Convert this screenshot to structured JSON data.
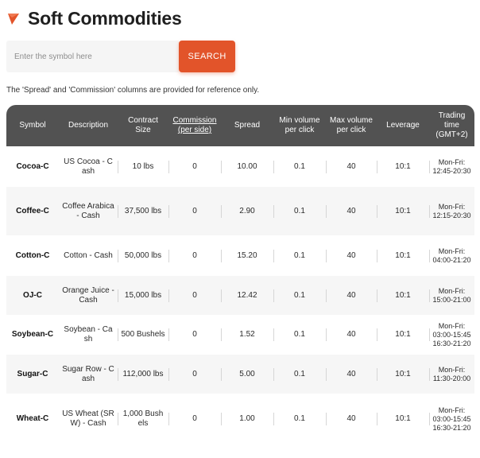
{
  "page": {
    "title": "Soft Commodities",
    "accent_color": "#e2542a",
    "header_bg": "#525252"
  },
  "search": {
    "placeholder": "Enter the symbol here",
    "button_label": "SEARCH"
  },
  "note": "The 'Spread' and 'Commission' columns are provided for reference only.",
  "table": {
    "headers": {
      "symbol": "Symbol",
      "description": "Description",
      "contract_size": "Contract Size",
      "commission": "Commission (per side)",
      "spread": "Spread",
      "min_volume": "Min volume per click",
      "max_volume": "Max volume per click",
      "leverage": "Leverage",
      "trading_time": "Trading time (GMT+2)"
    },
    "rows": [
      {
        "symbol": "Cocoa-C",
        "description": "US Cocoa - Cash",
        "contract_size": "10 lbs",
        "commission": "0",
        "spread": "10.00",
        "min_volume": "0.1",
        "max_volume": "40",
        "leverage": "10:1",
        "trading_time": [
          "Mon-Fri:",
          "12:45-20:30"
        ]
      },
      {
        "symbol": "Coffee-C",
        "description": "Coffee Arabica - Cash",
        "contract_size": "37,500 lbs",
        "commission": "0",
        "spread": "2.90",
        "min_volume": "0.1",
        "max_volume": "40",
        "leverage": "10:1",
        "trading_time": [
          "Mon-Fri:",
          "12:15-20:30"
        ]
      },
      {
        "symbol": "Cotton-C",
        "description": "Cotton - Cash",
        "contract_size": "50,000 lbs",
        "commission": "0",
        "spread": "15.20",
        "min_volume": "0.1",
        "max_volume": "40",
        "leverage": "10:1",
        "trading_time": [
          "Mon-Fri:",
          "04:00-21:20"
        ]
      },
      {
        "symbol": "OJ-C",
        "description": "Orange Juice - Cash",
        "contract_size": "15,000 lbs",
        "commission": "0",
        "spread": "12.42",
        "min_volume": "0.1",
        "max_volume": "40",
        "leverage": "10:1",
        "trading_time": [
          "Mon-Fri:",
          "15:00-21:00"
        ]
      },
      {
        "symbol": "Soybean-C",
        "description": "Soybean - Cash",
        "contract_size": "500 Bushels",
        "commission": "0",
        "spread": "1.52",
        "min_volume": "0.1",
        "max_volume": "40",
        "leverage": "10:1",
        "trading_time": [
          "Mon-Fri:",
          "03:00-15:45",
          "16:30-21:20"
        ]
      },
      {
        "symbol": "Sugar-C",
        "description": "Sugar Row - Cash",
        "contract_size": "112,000 lbs",
        "commission": "0",
        "spread": "5.00",
        "min_volume": "0.1",
        "max_volume": "40",
        "leverage": "10:1",
        "trading_time": [
          "Mon-Fri:",
          "11:30-20:00"
        ]
      },
      {
        "symbol": "Wheat-C",
        "description": "US Wheat (SRW) - Cash",
        "contract_size": "1,000 Bushels",
        "commission": "0",
        "spread": "1.00",
        "min_volume": "0.1",
        "max_volume": "40",
        "leverage": "10:1",
        "trading_time": [
          "Mon-Fri:",
          "03:00-15:45",
          "16:30-21:20"
        ]
      }
    ]
  }
}
